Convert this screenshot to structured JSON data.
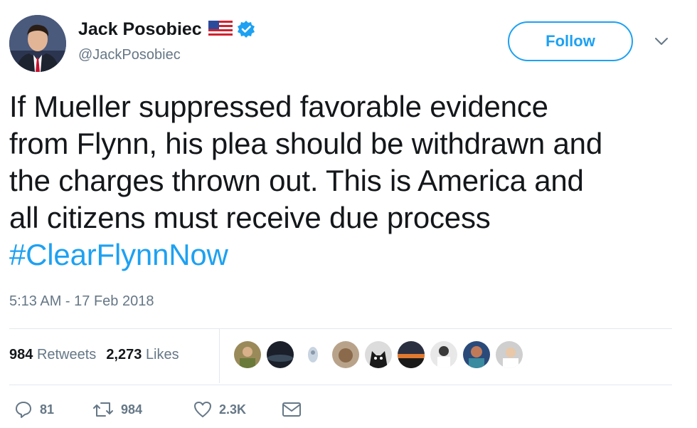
{
  "user": {
    "name": "Jack Posobiec",
    "handle": "@JackPosobiec"
  },
  "follow_label": "Follow",
  "tweet": {
    "lines": [
      "If Mueller suppressed favorable evidence",
      "from Flynn, his plea should be withdrawn and",
      "the charges thrown out. This is America and",
      "all citizens must receive due process"
    ],
    "hashtag": "#ClearFlynnNow",
    "timestamp": "5:13 AM - 17 Feb 2018"
  },
  "stats": {
    "retweets_count": "984",
    "retweets_label": "Retweets",
    "likes_count": "2,273",
    "likes_label": "Likes"
  },
  "actions": {
    "reply_count": "81",
    "retweet_count": "984",
    "like_count": "2.3K"
  },
  "colors": {
    "accent": "#1da1f2",
    "secondary_text": "#657786",
    "divider": "#e1e8ed"
  },
  "icons": [
    "flag-icon",
    "verified-badge-icon",
    "chevron-down-icon",
    "reply-icon",
    "retweet-icon",
    "heart-icon",
    "message-icon"
  ]
}
